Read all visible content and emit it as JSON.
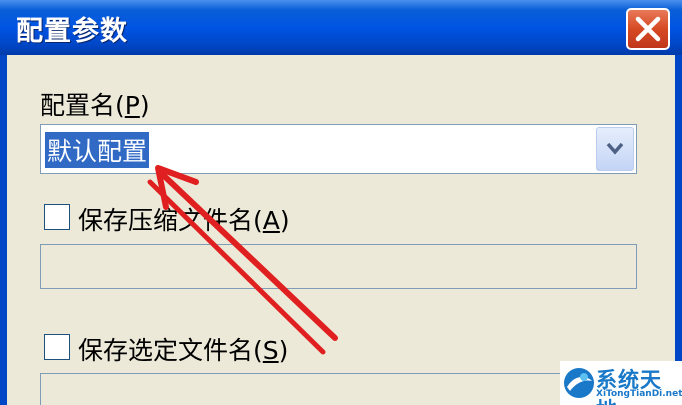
{
  "window": {
    "title": "配置参数",
    "close_icon": "close-icon"
  },
  "profile": {
    "label_text": "配置名(",
    "label_key": "P",
    "label_end": ")",
    "selected_value": "默认配置"
  },
  "save_archive_name": {
    "label_text": "保存压缩文件名(",
    "label_key": "A",
    "label_end": ")",
    "checked": false,
    "value": ""
  },
  "save_selected_name": {
    "label_text": "保存选定文件名(",
    "label_key": "S",
    "label_end": ")",
    "checked": false,
    "value": ""
  },
  "annotation": {
    "arrow_color": "#e02020"
  },
  "watermark": {
    "name": "系统天地",
    "site": "XiTongTianDi.net",
    "logo_icon": "xitongtiandi-logo-icon"
  },
  "colors": {
    "titlebar": "#0054e3",
    "selection": "#316ac5",
    "dialog": "#ece9d8"
  }
}
